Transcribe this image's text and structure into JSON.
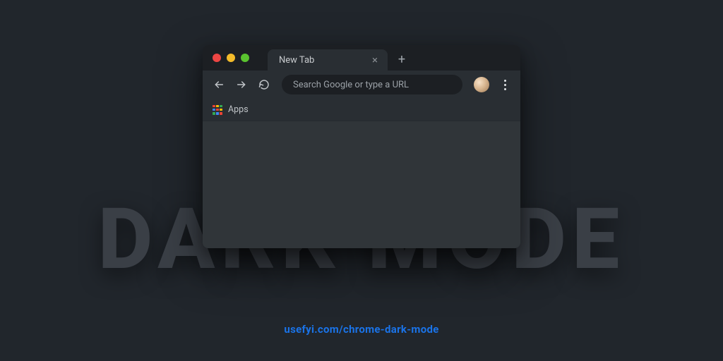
{
  "background_text": "DARK MODE",
  "footer_url": "usefyi.com/chrome-dark-mode",
  "browser": {
    "tab": {
      "title": "New Tab"
    },
    "omnibox": {
      "placeholder": "Search Google or type a URL"
    },
    "bookmarks": {
      "apps_label": "Apps"
    }
  }
}
